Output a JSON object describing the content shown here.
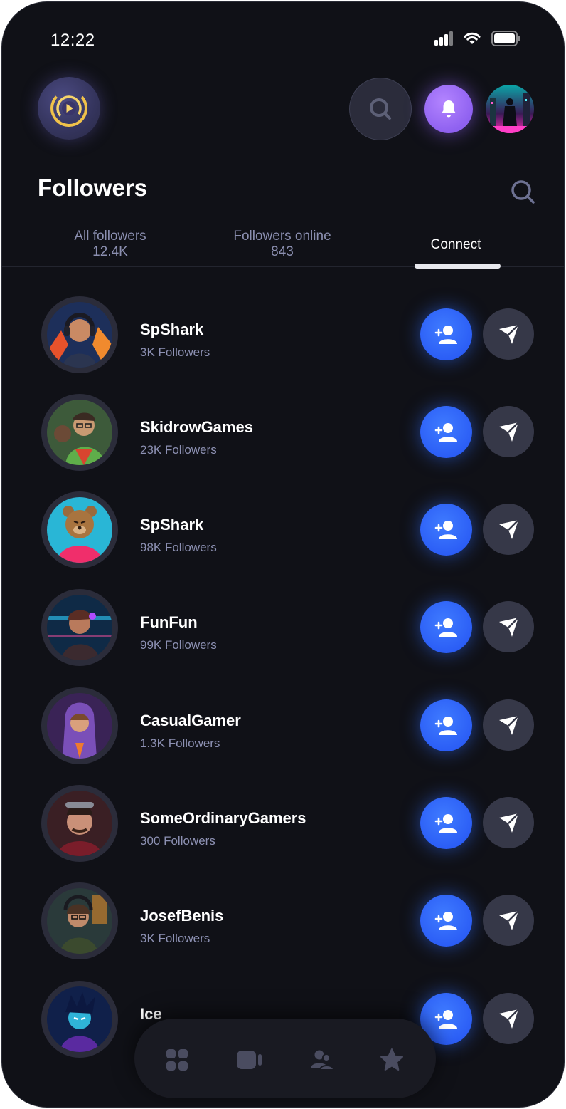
{
  "status_bar": {
    "time": "12:22"
  },
  "page": {
    "title": "Followers"
  },
  "tabs": [
    {
      "label": "All followers",
      "count": "12.4K",
      "active": false
    },
    {
      "label": "Followers online",
      "count": "843",
      "active": false
    },
    {
      "label": "Connect",
      "count": "",
      "active": true
    }
  ],
  "users": [
    {
      "name": "SpShark",
      "followers": "3K Followers"
    },
    {
      "name": "SkidrowGames",
      "followers": "23K Followers"
    },
    {
      "name": "SpShark",
      "followers": "98K Followers"
    },
    {
      "name": "FunFun",
      "followers": "99K Followers"
    },
    {
      "name": "CasualGamer",
      "followers": "1.3K Followers"
    },
    {
      "name": "SomeOrdinaryGamers",
      "followers": "300 Followers"
    },
    {
      "name": "JosefBenis",
      "followers": "3K Followers"
    },
    {
      "name": "Ice",
      "followers": ""
    }
  ],
  "bottom_nav": [
    {
      "icon": "grid-icon"
    },
    {
      "icon": "video-icon"
    },
    {
      "icon": "users-icon"
    },
    {
      "icon": "star-icon"
    }
  ],
  "colors": {
    "background": "#101117",
    "accent_blue": "#2a5cf5",
    "accent_purple": "#8f61f0",
    "secondary_button": "#363848",
    "muted_text": "#8d91b3"
  }
}
